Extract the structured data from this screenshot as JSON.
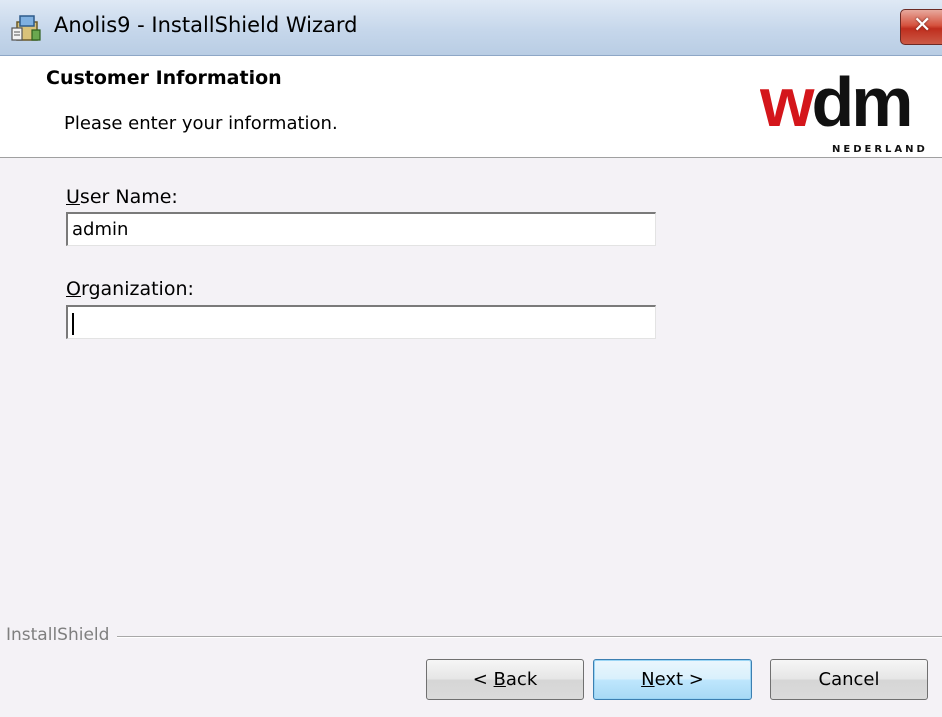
{
  "window": {
    "title": "Anolis9 - InstallShield Wizard",
    "close_glyph": "✕"
  },
  "header": {
    "title": "Customer Information",
    "subtitle": "Please enter your information.",
    "logo_text": "wdm",
    "logo_subtext": "NEDERLAND",
    "logo_colors": {
      "w": "#d4161b",
      "dm": "#111111"
    }
  },
  "form": {
    "user_name": {
      "label_mnemonic": "U",
      "label_rest": "ser Name:",
      "value": "admin"
    },
    "organization": {
      "label_mnemonic": "O",
      "label_rest": "rganization:",
      "value": ""
    }
  },
  "footer": {
    "brand": "InstallShield",
    "back": {
      "prefix": "< ",
      "mnemonic": "B",
      "rest": "ack"
    },
    "next": {
      "mnemonic": "N",
      "rest": "ext >"
    },
    "cancel": "Cancel"
  }
}
